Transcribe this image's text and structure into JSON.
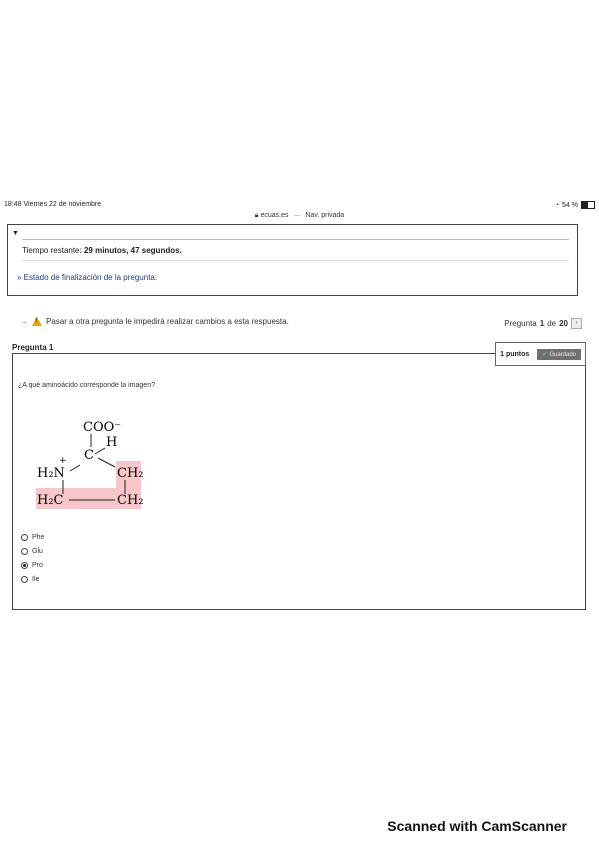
{
  "status_bar": {
    "time_date": "18:48   Viernes 22 de noviembre",
    "battery": "54 %",
    "battery_level": 0.54
  },
  "url_bar": {
    "site": "ecuas.es",
    "mode": "Nav. privada"
  },
  "timer": {
    "label": "Tiempo restante:",
    "value": "29 minutos, 47 segundos."
  },
  "status_link": "» Estado de finalización de la pregunta:",
  "warning": "Pasar a otra pregunta le impedirá realizar cambios a esta respuesta.",
  "pager": {
    "prefix": "Pregunta",
    "current": "1",
    "of": "de",
    "total": "20"
  },
  "question": {
    "title": "Pregunta 1",
    "points": "1 puntos",
    "saved_label": "Guardado",
    "text": "¿A qué aminoácido corresponde la imagen?",
    "options": [
      {
        "label": "Phe",
        "checked": false
      },
      {
        "label": "Glu",
        "checked": false
      },
      {
        "label": "Pro",
        "checked": true
      },
      {
        "label": "Ile",
        "checked": false
      }
    ]
  },
  "molecule": {
    "carboxyl": "COO⁻",
    "h": "H",
    "alpha_c": "C",
    "amine": "H₂N",
    "amine_charge": "+",
    "ch2_right": "CH₂",
    "ch2_left": "H₂C",
    "ch2_bottom": "CH₂",
    "highlight_color": "#f7c6cb"
  },
  "footer": "Scanned with CamScanner"
}
